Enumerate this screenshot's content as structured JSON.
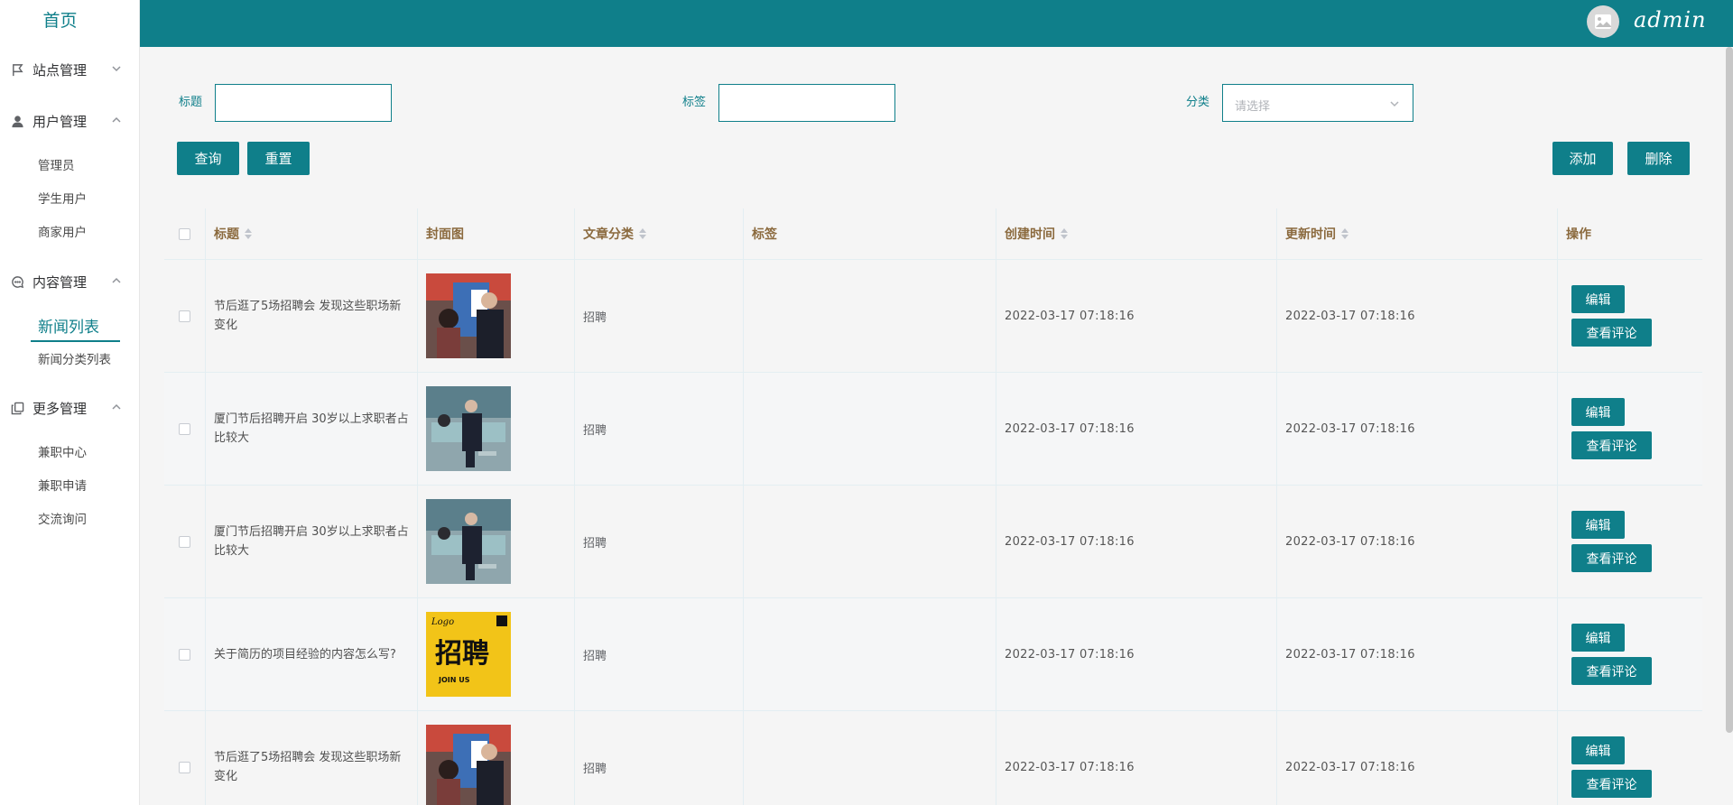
{
  "sidebar": {
    "home": "首页",
    "groups": [
      {
        "label": "站点管理",
        "icon": "flag-icon",
        "expanded": false
      },
      {
        "label": "用户管理",
        "icon": "user-icon",
        "expanded": true
      },
      {
        "label": "内容管理",
        "icon": "chat-icon",
        "expanded": true
      },
      {
        "label": "更多管理",
        "icon": "copy-icon",
        "expanded": true
      }
    ],
    "user_items": [
      "管理员",
      "学生用户",
      "商家用户"
    ],
    "content_items": [
      "新闻列表",
      "新闻分类列表"
    ],
    "more_items": [
      "兼职中心",
      "兼职申请",
      "交流询问"
    ],
    "active_item": "新闻列表"
  },
  "header": {
    "username": "admin",
    "avatar_icon": "image-icon",
    "color": "#0f7f8a"
  },
  "filters": {
    "title_label": "标题",
    "title_value": "",
    "tag_label": "标签",
    "tag_value": "",
    "category_label": "分类",
    "category_placeholder": "请选择"
  },
  "buttons": {
    "query": "查询",
    "reset": "重置",
    "add": "添加",
    "delete": "删除"
  },
  "table": {
    "columns": [
      "标题",
      "封面图",
      "文章分类",
      "标签",
      "创建时间",
      "更新时间",
      "操作"
    ],
    "rows": [
      {
        "title": "节后逛了5场招聘会 发现这些职场新变化",
        "cover": "job-fair-photo",
        "category": "招聘",
        "tag": "",
        "created": "2022-03-17 07:18:16",
        "updated": "2022-03-17 07:18:16"
      },
      {
        "title": "厦门节后招聘开启 30岁以上求职者占比较大",
        "cover": "interview-desk-photo",
        "category": "招聘",
        "tag": "",
        "created": "2022-03-17 07:18:16",
        "updated": "2022-03-17 07:18:16"
      },
      {
        "title": "厦门节后招聘开启 30岁以上求职者占比较大",
        "cover": "interview-desk-photo",
        "category": "招聘",
        "tag": "",
        "created": "2022-03-17 07:18:16",
        "updated": "2022-03-17 07:18:16"
      },
      {
        "title": "关于简历的项目经验的内容怎么写?",
        "cover": "recruit-poster",
        "category": "招聘",
        "tag": "",
        "created": "2022-03-17 07:18:16",
        "updated": "2022-03-17 07:18:16"
      },
      {
        "title": "节后逛了5场招聘会 发现这些职场新变化",
        "cover": "job-fair-photo",
        "category": "招聘",
        "tag": "",
        "created": "2022-03-17 07:18:16",
        "updated": "2022-03-17 07:18:16"
      }
    ],
    "edit_label": "编辑",
    "comments_label": "查看评论"
  },
  "poster": {
    "logo": "Logo",
    "main": "招聘",
    "join": "JOIN US"
  }
}
